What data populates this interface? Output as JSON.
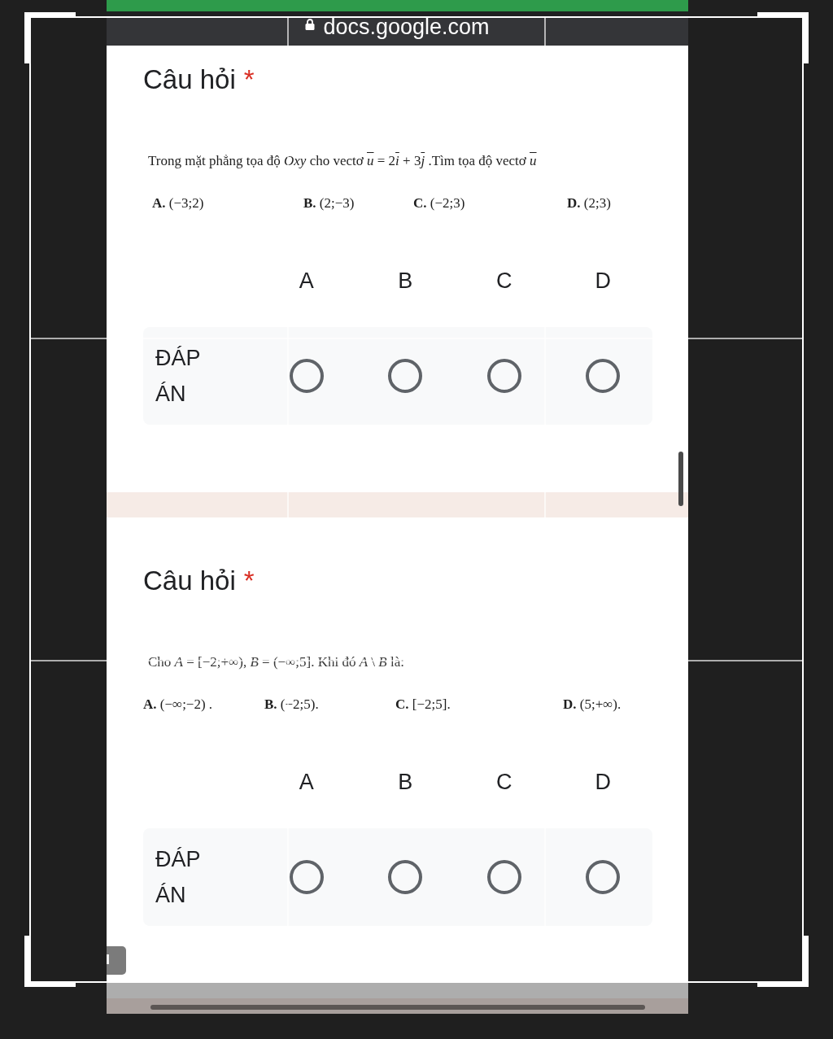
{
  "browser": {
    "url": "docs.google.com"
  },
  "questions": [
    {
      "title": "Câu hỏi",
      "required_mark": "*",
      "text_parts": [
        {
          "kind": "plain",
          "text": "Trong mặt phẳng tọa độ "
        },
        {
          "kind": "italic",
          "text": "Oxy"
        },
        {
          "kind": "plain",
          "text": " cho vectơ "
        },
        {
          "kind": "vector",
          "text": "u"
        },
        {
          "kind": "plain",
          "text": " = 2"
        },
        {
          "kind": "vector",
          "text": "i"
        },
        {
          "kind": "plain",
          "text": " + 3"
        },
        {
          "kind": "vector",
          "text": "j"
        },
        {
          "kind": "plain",
          "text": " .Tìm tọa độ vectơ "
        },
        {
          "kind": "vector",
          "text": "u"
        }
      ],
      "options": [
        "**A.** (−3;2)",
        "**B.** (2;−3)",
        "**C.** (−2;3)",
        "**D.** (2;3)"
      ],
      "grid": {
        "columns": [
          "A",
          "B",
          "C",
          "D"
        ],
        "rows": [
          {
            "label": "ĐÁP ÁN",
            "choices": [
              {
                "selected": false
              },
              {
                "selected": false
              },
              {
                "selected": false
              },
              {
                "selected": false
              }
            ]
          }
        ]
      }
    },
    {
      "title": "Câu hỏi",
      "required_mark": "*",
      "text_parts": [
        {
          "kind": "plain",
          "text": "Cho "
        },
        {
          "kind": "italic",
          "text": "A"
        },
        {
          "kind": "plain",
          "text": " = [−2;+∞), "
        },
        {
          "kind": "italic",
          "text": "B"
        },
        {
          "kind": "plain",
          "text": " = (−∞;5]. Khi đó "
        },
        {
          "kind": "italic",
          "text": "A"
        },
        {
          "kind": "plain",
          "text": " \\ "
        },
        {
          "kind": "italic",
          "text": "B"
        },
        {
          "kind": "plain",
          "text": " là:"
        }
      ],
      "options": [
        "**A.** (−∞;−2) .",
        "**B.** (−2;5).",
        "**C.** [−2;5].",
        "**D.** (5;+∞)."
      ],
      "grid": {
        "columns": [
          "A",
          "B",
          "C",
          "D"
        ],
        "rows": [
          {
            "label": "ĐÁP ÁN",
            "choices": [
              {
                "selected": false
              },
              {
                "selected": false
              },
              {
                "selected": false
              },
              {
                "selected": false
              }
            ]
          }
        ]
      }
    }
  ]
}
